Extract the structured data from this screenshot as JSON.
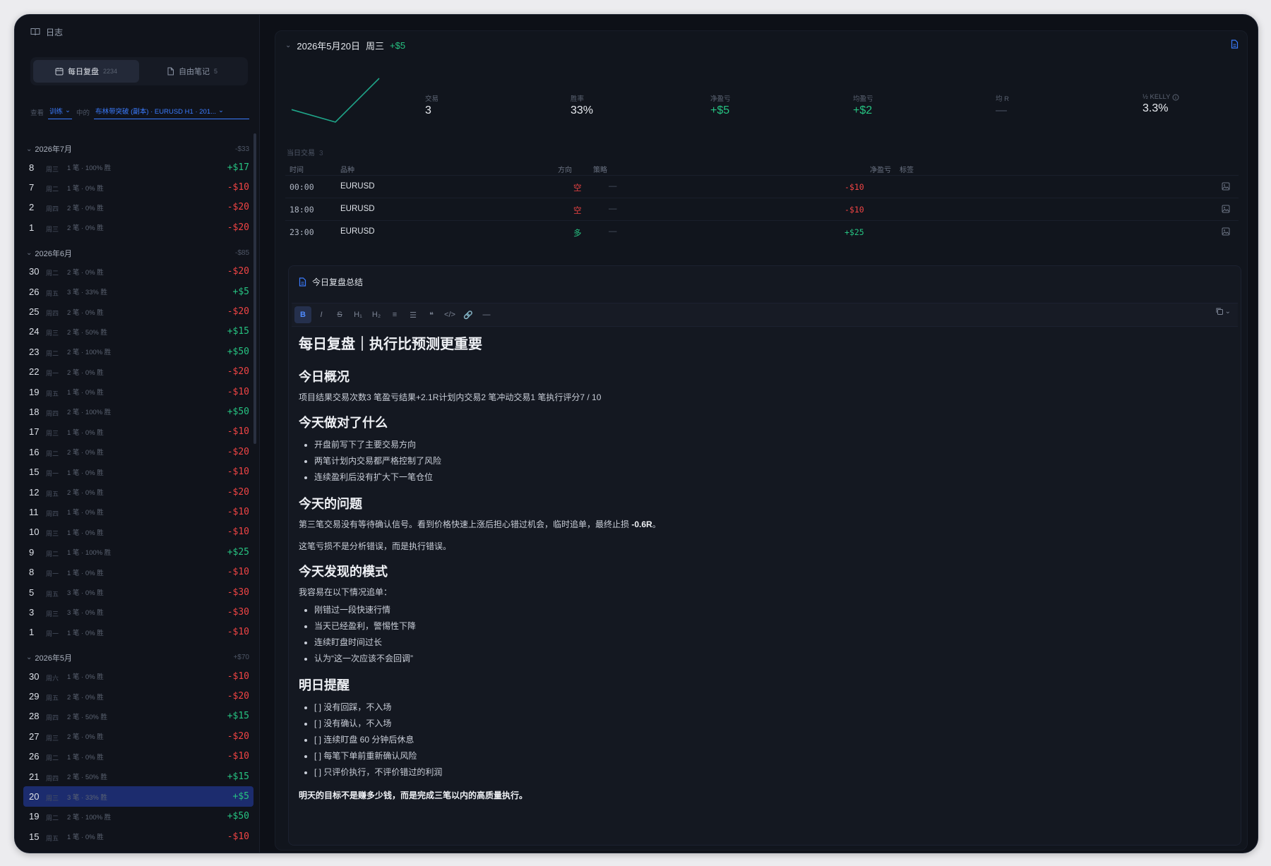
{
  "sidebar": {
    "title": "日志",
    "tabs": [
      {
        "label": "每日复盘",
        "count": "2234"
      },
      {
        "label": "自由笔记",
        "count": "5"
      }
    ],
    "filter": {
      "view_label": "查看",
      "view_value": "训练",
      "in_label": "中的",
      "source_value": "布林带突破 (副本) · EURUSD H1 · 201..."
    },
    "months": [
      {
        "label": "2026年7月",
        "sum": "-$33",
        "days": [
          {
            "d": "8",
            "wd": "周三",
            "meta": "1 笔 · 100% 胜",
            "pnl": "+$17",
            "pos": true
          },
          {
            "d": "7",
            "wd": "周二",
            "meta": "1 笔 · 0% 胜",
            "pnl": "-$10",
            "pos": false
          },
          {
            "d": "2",
            "wd": "周四",
            "meta": "2 笔 · 0% 胜",
            "pnl": "-$20",
            "pos": false
          },
          {
            "d": "1",
            "wd": "周三",
            "meta": "2 笔 · 0% 胜",
            "pnl": "-$20",
            "pos": false
          }
        ]
      },
      {
        "label": "2026年6月",
        "sum": "-$85",
        "days": [
          {
            "d": "30",
            "wd": "周二",
            "meta": "2 笔 · 0% 胜",
            "pnl": "-$20",
            "pos": false
          },
          {
            "d": "26",
            "wd": "周五",
            "meta": "3 笔 · 33% 胜",
            "pnl": "+$5",
            "pos": true
          },
          {
            "d": "25",
            "wd": "周四",
            "meta": "2 笔 · 0% 胜",
            "pnl": "-$20",
            "pos": false
          },
          {
            "d": "24",
            "wd": "周三",
            "meta": "2 笔 · 50% 胜",
            "pnl": "+$15",
            "pos": true
          },
          {
            "d": "23",
            "wd": "周二",
            "meta": "2 笔 · 100% 胜",
            "pnl": "+$50",
            "pos": true
          },
          {
            "d": "22",
            "wd": "周一",
            "meta": "2 笔 · 0% 胜",
            "pnl": "-$20",
            "pos": false
          },
          {
            "d": "19",
            "wd": "周五",
            "meta": "1 笔 · 0% 胜",
            "pnl": "-$10",
            "pos": false
          },
          {
            "d": "18",
            "wd": "周四",
            "meta": "2 笔 · 100% 胜",
            "pnl": "+$50",
            "pos": true
          },
          {
            "d": "17",
            "wd": "周三",
            "meta": "1 笔 · 0% 胜",
            "pnl": "-$10",
            "pos": false
          },
          {
            "d": "16",
            "wd": "周二",
            "meta": "2 笔 · 0% 胜",
            "pnl": "-$20",
            "pos": false
          },
          {
            "d": "15",
            "wd": "周一",
            "meta": "1 笔 · 0% 胜",
            "pnl": "-$10",
            "pos": false
          },
          {
            "d": "12",
            "wd": "周五",
            "meta": "2 笔 · 0% 胜",
            "pnl": "-$20",
            "pos": false
          },
          {
            "d": "11",
            "wd": "周四",
            "meta": "1 笔 · 0% 胜",
            "pnl": "-$10",
            "pos": false
          },
          {
            "d": "10",
            "wd": "周三",
            "meta": "1 笔 · 0% 胜",
            "pnl": "-$10",
            "pos": false
          },
          {
            "d": "9",
            "wd": "周二",
            "meta": "1 笔 · 100% 胜",
            "pnl": "+$25",
            "pos": true
          },
          {
            "d": "8",
            "wd": "周一",
            "meta": "1 笔 · 0% 胜",
            "pnl": "-$10",
            "pos": false
          },
          {
            "d": "5",
            "wd": "周五",
            "meta": "3 笔 · 0% 胜",
            "pnl": "-$30",
            "pos": false
          },
          {
            "d": "3",
            "wd": "周三",
            "meta": "3 笔 · 0% 胜",
            "pnl": "-$30",
            "pos": false
          },
          {
            "d": "1",
            "wd": "周一",
            "meta": "1 笔 · 0% 胜",
            "pnl": "-$10",
            "pos": false
          }
        ]
      },
      {
        "label": "2026年5月",
        "sum": "+$70",
        "days": [
          {
            "d": "30",
            "wd": "周六",
            "meta": "1 笔 · 0% 胜",
            "pnl": "-$10",
            "pos": false
          },
          {
            "d": "29",
            "wd": "周五",
            "meta": "2 笔 · 0% 胜",
            "pnl": "-$20",
            "pos": false
          },
          {
            "d": "28",
            "wd": "周四",
            "meta": "2 笔 · 50% 胜",
            "pnl": "+$15",
            "pos": true
          },
          {
            "d": "27",
            "wd": "周三",
            "meta": "2 笔 · 0% 胜",
            "pnl": "-$20",
            "pos": false
          },
          {
            "d": "26",
            "wd": "周二",
            "meta": "1 笔 · 0% 胜",
            "pnl": "-$10",
            "pos": false
          },
          {
            "d": "21",
            "wd": "周四",
            "meta": "2 笔 · 50% 胜",
            "pnl": "+$15",
            "pos": true
          },
          {
            "d": "20",
            "wd": "周三",
            "meta": "3 笔 · 33% 胜",
            "pnl": "+$5",
            "pos": true,
            "selected": true
          },
          {
            "d": "19",
            "wd": "周二",
            "meta": "2 笔 · 100% 胜",
            "pnl": "+$50",
            "pos": true
          },
          {
            "d": "15",
            "wd": "周五",
            "meta": "1 笔 · 0% 胜",
            "pnl": "-$10",
            "pos": false
          }
        ]
      }
    ]
  },
  "day": {
    "date": "2026年5月20日",
    "weekday": "周三",
    "pnl": "+$5",
    "sparkline": [
      0,
      -10,
      25
    ],
    "stats": [
      {
        "label": "交易",
        "value": "3"
      },
      {
        "label": "胜率",
        "value": "33%"
      },
      {
        "label": "净盈亏",
        "value": "+$5"
      },
      {
        "label": "均盈亏",
        "value": "+$2"
      },
      {
        "label": "均 R",
        "value": "—"
      },
      {
        "label": "½ KELLY",
        "value": "3.3%"
      }
    ],
    "trades_title": "当日交易",
    "trades_count": "3",
    "columns": {
      "time": "时间",
      "symbol": "品种",
      "dir": "方向",
      "strategy": "策略",
      "pnl": "净盈亏",
      "tags": "标签"
    },
    "trades": [
      {
        "time": "00:00",
        "symbol": "EURUSD",
        "dir": "空",
        "strategy": "—",
        "pnl": "-$10",
        "long": false
      },
      {
        "time": "18:00",
        "symbol": "EURUSD",
        "dir": "空",
        "strategy": "—",
        "pnl": "-$10",
        "long": false
      },
      {
        "time": "23:00",
        "symbol": "EURUSD",
        "dir": "多",
        "strategy": "—",
        "pnl": "+$25",
        "long": true
      }
    ]
  },
  "editor": {
    "title": "今日复盘总结",
    "toolbar": [
      "B",
      "I",
      "S",
      "H₁",
      "H₂",
      "≡",
      "☰",
      "❝",
      "</>",
      "🔗",
      "—"
    ],
    "doc": {
      "h1": "每日复盘｜执行比预测更重要",
      "s1_title": "今日概况",
      "s1_text": "项目结果交易次数3 笔盈亏结果+2.1R计划内交易2 笔冲动交易1 笔执行评分7 / 10",
      "s2_title": "今天做对了什么",
      "s2_items": [
        "开盘前写下了主要交易方向",
        "两笔计划内交易都严格控制了风险",
        "连续盈利后没有扩大下一笔仓位"
      ],
      "s3_title": "今天的问题",
      "s3_text_a": "第三笔交易没有等待确认信号。看到价格快速上涨后担心错过机会，临时追单，最终止损 ",
      "s3_text_b": "-0.6R",
      "s3_text_c": "。",
      "s3_text2": "这笔亏损不是分析错误，而是执行错误。",
      "s4_title": "今天发现的模式",
      "s4_text": "我容易在以下情况追单：",
      "s4_items": [
        "刚错过一段快速行情",
        "当天已经盈利，警惕性下降",
        "连续盯盘时间过长",
        "认为“这一次应该不会回调”"
      ],
      "s5_title": "明日提醒",
      "s5_items": [
        "[ ] 没有回踩，不入场",
        "[ ] 没有确认，不入场",
        "[ ] 连续盯盘 60 分钟后休息",
        "[ ] 每笔下单前重新确认风险",
        "[ ] 只评价执行，不评价错过的利润"
      ],
      "closing": "明天的目标不是赚多少钱，而是完成三笔以内的高质量执行。"
    }
  }
}
